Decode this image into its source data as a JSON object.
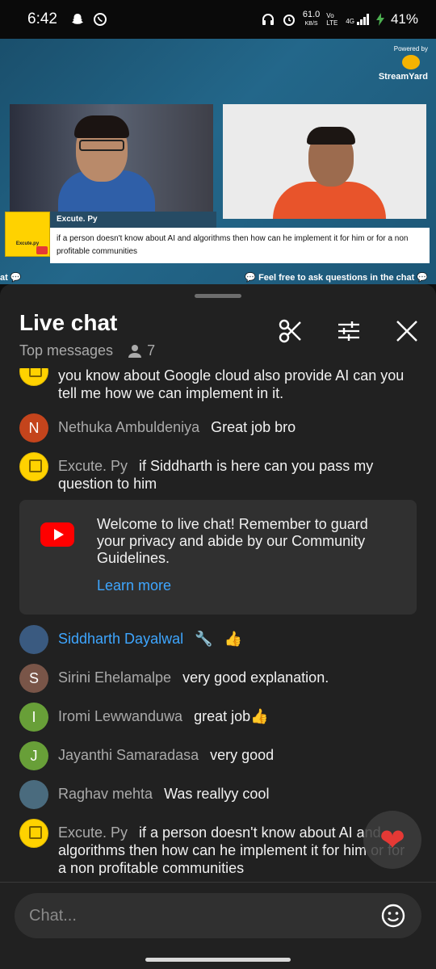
{
  "status_bar": {
    "time": "6:42",
    "net_speed": "61.0",
    "net_unit": "KB/S",
    "vo_lte": "Vo LTE",
    "signal": "4G",
    "battery": "41%"
  },
  "video": {
    "powered_by": "Powered by",
    "brand": "StreamYard",
    "channel_logo_text": "Excute.py",
    "banner_name": "Excute. Py",
    "banner_question": "if a person doesn't know about AI and algorithms then how can he implement it for him or for a non profitable communities",
    "ticker_left": "at 💬",
    "ticker_right": "💬 Feel free to ask questions in the chat 💬"
  },
  "chat": {
    "title": "Live chat",
    "mode": "Top messages",
    "viewer_count": "7",
    "messages": [
      {
        "author": "",
        "text": "you know about Google cloud also provide AI can you tell me how we can implement in it.",
        "avatar_letter": "",
        "avatar_color": "#ffd200"
      },
      {
        "author": "Nethuka Ambuldeniya",
        "text": "Great job bro",
        "avatar_letter": "N",
        "avatar_color": "#c4441c"
      },
      {
        "author": "Excute. Py",
        "text": "if Siddharth is here can you pass my question to him",
        "avatar_letter": "",
        "avatar_color": "#ffd200"
      },
      {
        "author": "Siddharth Dayalwal",
        "badge": "🔧",
        "text": "👍",
        "avatar_letter": "",
        "avatar_color": "#3a5a80"
      },
      {
        "author": "Sirini Ehelamalpe",
        "text": "very good explanation.",
        "avatar_letter": "S",
        "avatar_color": "#795548"
      },
      {
        "author": "Iromi Lewwanduwa",
        "text": "great job👍",
        "avatar_letter": "I",
        "avatar_color": "#689f38"
      },
      {
        "author": "Jayanthi Samaradasa",
        "text": "very good",
        "avatar_letter": "J",
        "avatar_color": "#689f38"
      },
      {
        "author": "Raghav mehta",
        "text": "Was reallyy cool",
        "avatar_letter": "",
        "avatar_color": "#4a6b7e"
      },
      {
        "author": "Excute. Py",
        "text": "if a person doesn't know about AI and algorithms then how can he implement it for him or for a non profitable communities",
        "avatar_letter": "",
        "avatar_color": "#ffd200"
      }
    ],
    "welcome": {
      "text": "Welcome to live chat! Remember to guard your privacy and abide by our Community Guidelines.",
      "link": "Learn more"
    },
    "input_placeholder": "Chat..."
  },
  "icons": {
    "scissors": "scissors-icon",
    "filters": "sliders-icon",
    "close": "close-icon",
    "emoji": "emoji-icon",
    "heart": "heart-icon",
    "viewers": "person-icon"
  },
  "colors": {
    "panel_bg": "#212121",
    "owner_name": "#3ea6ff",
    "link": "#3ea6ff",
    "youtube_red": "#ff0000"
  }
}
